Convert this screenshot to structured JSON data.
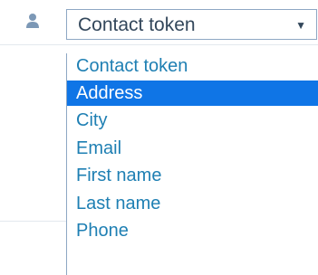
{
  "field": {
    "icon": "person-icon",
    "select_value": "Contact token",
    "arrow_icon": "caret-down-icon"
  },
  "dropdown": {
    "options": [
      {
        "label": "Contact token",
        "selected": false
      },
      {
        "label": "Address",
        "selected": true
      },
      {
        "label": "City",
        "selected": false
      },
      {
        "label": "Email",
        "selected": false
      },
      {
        "label": "First name",
        "selected": false
      },
      {
        "label": "Last name",
        "selected": false
      },
      {
        "label": "Phone",
        "selected": false
      }
    ]
  },
  "colors": {
    "text": "#33475b",
    "option_text": "#1e7fb3",
    "selected_bg": "#0f75e6",
    "selected_text": "#ffffff",
    "border": "#8ea7c4",
    "icon": "#7c98b6"
  }
}
